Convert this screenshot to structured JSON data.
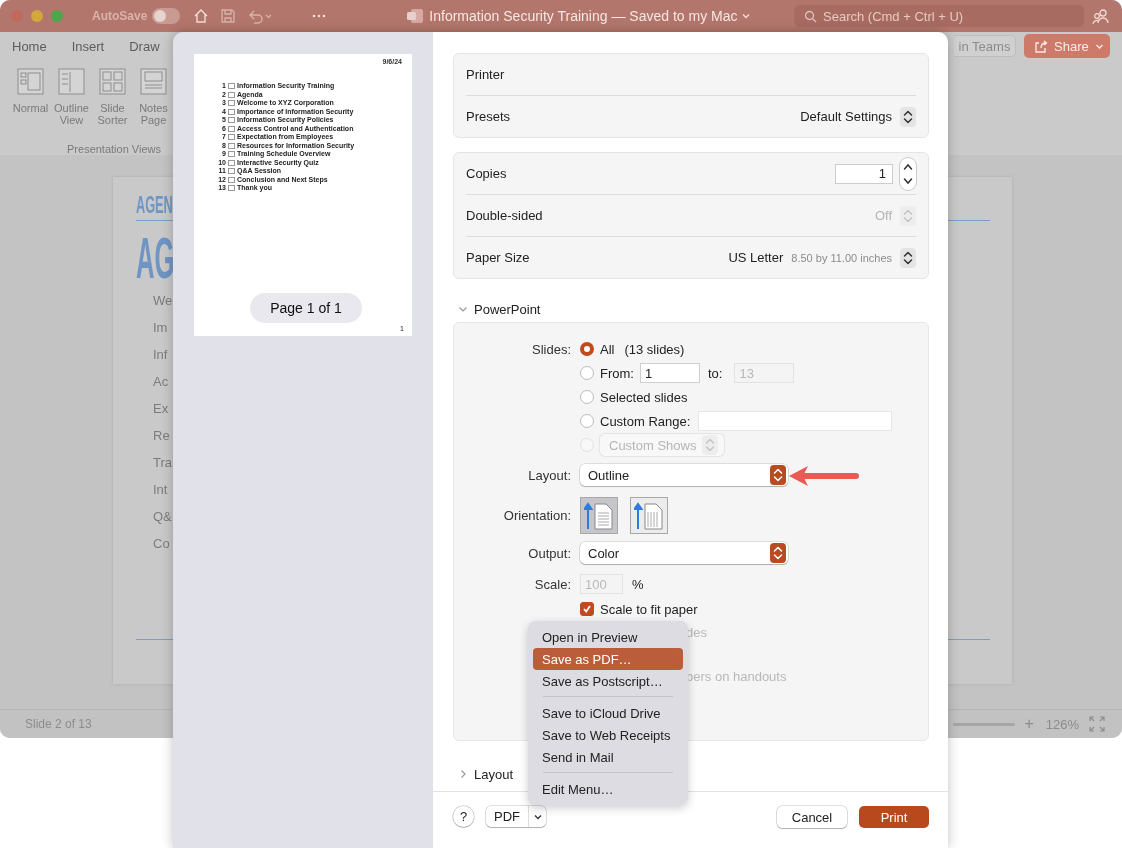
{
  "app_window": {
    "title_bar": {
      "autosave": {
        "label": "AutoSave",
        "on": false
      },
      "title": "Information Security Training — Saved to my Mac",
      "search": {
        "placeholder": "Search (Cmd + Ctrl + U)"
      }
    },
    "ribbon": {
      "tabs": [
        "Home",
        "Insert",
        "Draw"
      ],
      "teams_button": "in Teams",
      "share_button": "Share",
      "view_buttons": [
        "Normal",
        "Outline View",
        "Slide Sorter",
        "Notes Page"
      ],
      "group_label": "Presentation Views"
    },
    "slide": {
      "heading_small": "AGEN",
      "heading_large": "AG",
      "bullets": [
        "We",
        "Im",
        "Inf",
        "Ac",
        "Ex",
        "Re",
        "Tra",
        "Int",
        "Q&",
        "Co"
      ]
    },
    "status_bar": {
      "slide_counter": "Slide 2 of 13",
      "zoom_in": "+",
      "zoom": "126%"
    }
  },
  "print_dialog": {
    "preview": {
      "date": "9/6/24",
      "outline": [
        {
          "number": "1",
          "title": "Information Security Training",
          "checked": false
        },
        {
          "number": "2",
          "title": "Agenda",
          "checked": false
        },
        {
          "number": "3",
          "title": "Welcome to XYZ Corporation",
          "checked": false
        },
        {
          "number": "4",
          "title": "Importance of Information Security",
          "checked": false
        },
        {
          "number": "5",
          "title": "Information Security Policies",
          "checked": false
        },
        {
          "number": "6",
          "title": "Access Control and Authentication",
          "checked": false
        },
        {
          "number": "7",
          "title": "Expectation from Employees",
          "checked": false
        },
        {
          "number": "8",
          "title": "Resources for Information Security",
          "checked": false
        },
        {
          "number": "9",
          "title": "Training Schedule Overview",
          "checked": false
        },
        {
          "number": "10",
          "title": "Interactive Security Quiz",
          "checked": false
        },
        {
          "number": "11",
          "title": "Q&A Session",
          "checked": false
        },
        {
          "number": "12",
          "title": "Conclusion and Next Steps",
          "checked": false
        },
        {
          "number": "13",
          "title": "Thank you",
          "checked": false
        }
      ],
      "page_number": "1",
      "page_indicator": "Page 1 of 1"
    },
    "general": [
      {
        "kind": "plain",
        "label": "Printer"
      },
      {
        "kind": "popup",
        "label": "Presets",
        "value": "Default Settings"
      }
    ],
    "options": [
      {
        "kind": "stepper",
        "label": "Copies",
        "value": "1",
        "disabled": false
      },
      {
        "kind": "popup",
        "label": "Double-sided",
        "value": "Off",
        "disabled": true
      },
      {
        "kind": "popup",
        "label": "Paper Size",
        "value": "US Letter",
        "detail": "8.50 by 11.00 inches",
        "disabled": false
      }
    ],
    "powerpoint": {
      "title": "PowerPoint",
      "expanded": true,
      "slides_label": "Slides:",
      "slide_options": [
        {
          "kind": "all",
          "label": "All",
          "note": "(13 slides)",
          "selected": true,
          "disabled": false
        },
        {
          "kind": "range",
          "label": "From:",
          "from": "1",
          "to_label": "to:",
          "to": "13",
          "selected": false,
          "disabled": false
        },
        {
          "kind": "plain",
          "label": "Selected slides",
          "selected": false,
          "disabled": false
        },
        {
          "kind": "custom_range",
          "label": "Custom Range:",
          "selected": false,
          "disabled": false
        },
        {
          "kind": "custom_shows",
          "label": "Custom Shows",
          "selected": false,
          "disabled": true
        }
      ],
      "layout": {
        "label": "Layout:",
        "value": "Outline"
      },
      "orientation": {
        "label": "Orientation:",
        "options": [
          {
            "kind": "portrait",
            "selected": true
          },
          {
            "kind": "landscape",
            "selected": false
          }
        ]
      },
      "output": {
        "label": "Output:",
        "value": "Color"
      },
      "scale": {
        "label": "Scale:",
        "value": "100",
        "unit": "%",
        "disabled": true
      },
      "scale_to_fit": {
        "label": "Scale to fit paper",
        "checked": true
      },
      "partial_texts": [
        "des",
        "bers on handouts"
      ]
    },
    "layout_section": {
      "title": "Layout",
      "expanded": false
    },
    "footer": {
      "help": "?",
      "pdf": "PDF",
      "cancel": "Cancel",
      "print": "Print"
    },
    "pdf_menu": {
      "items": [
        {
          "kind": "item",
          "label": "Open in Preview",
          "selected": false
        },
        {
          "kind": "item",
          "label": "Save as PDF…",
          "selected": true
        },
        {
          "kind": "item",
          "label": "Save as Postscript…",
          "selected": false
        },
        {
          "kind": "separator"
        },
        {
          "kind": "item",
          "label": "Save to iCloud Drive",
          "selected": false
        },
        {
          "kind": "item",
          "label": "Save to Web Receipts",
          "selected": false
        },
        {
          "kind": "item",
          "label": "Send in Mail",
          "selected": false
        },
        {
          "kind": "separator"
        },
        {
          "kind": "item",
          "label": "Edit Menu…",
          "selected": false
        }
      ]
    }
  }
}
